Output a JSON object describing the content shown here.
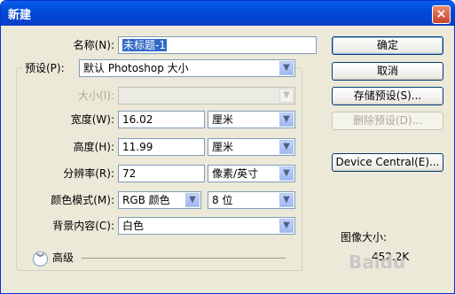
{
  "window": {
    "title": "新建"
  },
  "form": {
    "name_label": "名称(N):",
    "name_value": "未标题-1",
    "preset_label": "预设(P):",
    "preset_value": "默认 Photoshop 大小",
    "size_label": "大小(I):",
    "width_label": "宽度(W):",
    "width_value": "16.02",
    "width_unit": "厘米",
    "height_label": "高度(H):",
    "height_value": "11.99",
    "height_unit": "厘米",
    "resolution_label": "分辨率(R):",
    "resolution_value": "72",
    "resolution_unit": "像素/英寸",
    "color_mode_label": "颜色模式(M):",
    "color_mode_value": "RGB 颜色",
    "bit_depth_value": "8 位",
    "background_label": "背景内容(C):",
    "background_value": "白色",
    "advanced_label": "高级"
  },
  "buttons": {
    "ok": "确定",
    "cancel": "取消",
    "save_preset": "存储预设(S)...",
    "delete_preset": "删除预设(D)...",
    "device_central": "Device Central(E)..."
  },
  "info": {
    "image_size_label": "图像大小:",
    "image_size_value": "452.2K",
    "watermark": "Baidu"
  }
}
